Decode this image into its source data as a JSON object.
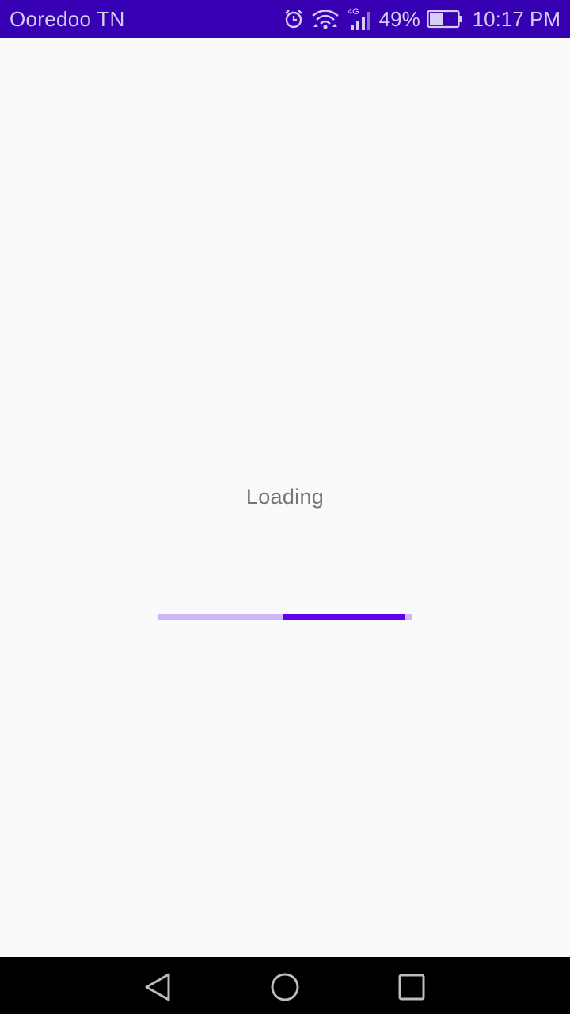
{
  "status_bar": {
    "carrier": "Ooredoo TN",
    "network_type": "4G",
    "battery_percent": "49%",
    "battery_level": 0.49,
    "time": "10:17 PM",
    "icons": [
      "alarm-icon",
      "wifi-icon",
      "cellular-signal-icon",
      "battery-icon"
    ],
    "background_color": "#3700b3"
  },
  "main": {
    "loading_label": "Loading",
    "progress": {
      "type": "indeterminate-linear",
      "track_color": "#cdb8f5",
      "indicator_color": "#6200ee"
    }
  },
  "nav_bar": {
    "buttons": [
      {
        "name": "back",
        "icon": "back-triangle-icon"
      },
      {
        "name": "home",
        "icon": "home-circle-icon"
      },
      {
        "name": "recents",
        "icon": "recents-square-icon"
      }
    ]
  }
}
